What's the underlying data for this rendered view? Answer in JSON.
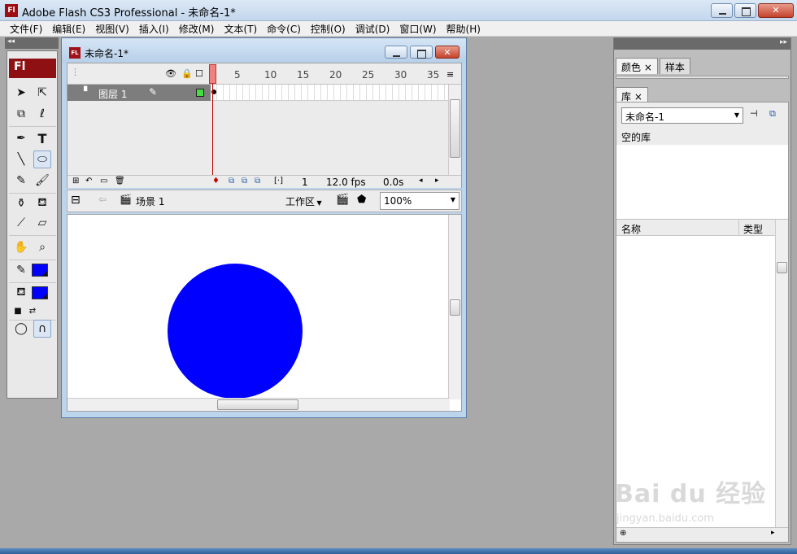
{
  "window": {
    "title": "Adobe Flash CS3 Professional - 未命名-1*",
    "app_icon_label": "Fl"
  },
  "menu": [
    "文件(F)",
    "编辑(E)",
    "视图(V)",
    "插入(I)",
    "修改(M)",
    "文本(T)",
    "命令(C)",
    "控制(O)",
    "调试(D)",
    "窗口(W)",
    "帮助(H)"
  ],
  "tools": {
    "logo": "Fl",
    "text_tool_glyph": "T",
    "stroke_color": "#0000ff",
    "fill_color": "#0000ff"
  },
  "document": {
    "title": "未命名-1*",
    "icon_label": "FL",
    "timeline": {
      "frame_numbers": [
        "1",
        "5",
        "10",
        "15",
        "20",
        "25",
        "30",
        "35"
      ],
      "layer_name": "图层 1",
      "layer_color": "#44dd44",
      "current_frame": "1",
      "fps": "12.0 fps",
      "elapsed": "0.0s"
    },
    "editbar": {
      "scene": "场景 1",
      "workspace": "工作区",
      "zoom": "100%"
    },
    "stage": {
      "background": "#ffffff",
      "shape": "circle",
      "shape_color": "#0000ff"
    }
  },
  "panels": {
    "color_tabs": [
      "颜色",
      "样本"
    ],
    "library_tab": "库",
    "library": {
      "selected_doc": "未命名-1",
      "empty_text": "空的库",
      "col_name": "名称",
      "col_type": "类型"
    }
  },
  "watermark": {
    "brand": "Bai du 经验",
    "url": "jingyan.baidu.com"
  }
}
